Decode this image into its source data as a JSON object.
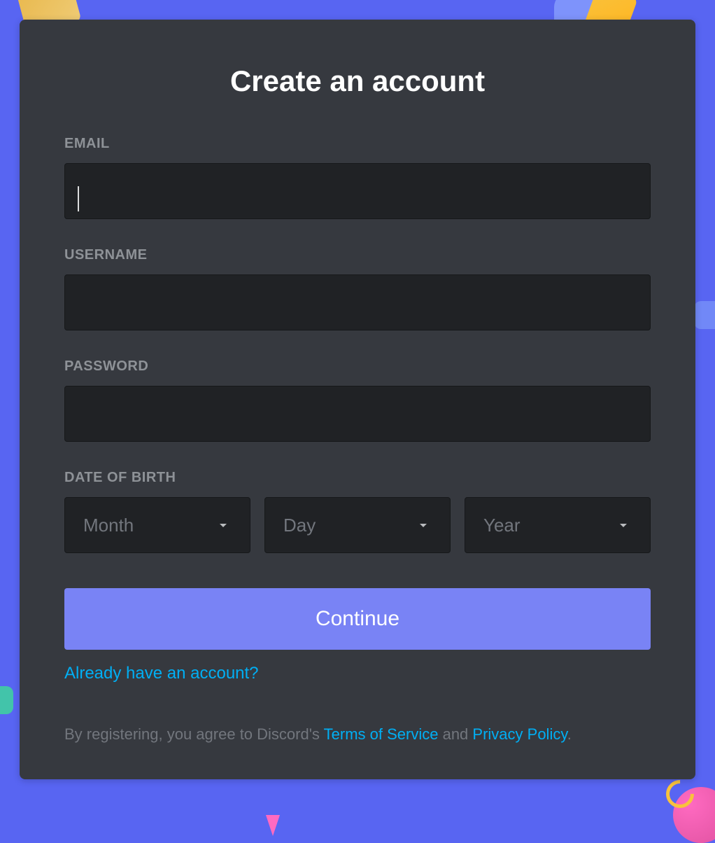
{
  "title": "Create an account",
  "fields": {
    "email": {
      "label": "EMAIL",
      "value": ""
    },
    "username": {
      "label": "USERNAME",
      "value": ""
    },
    "password": {
      "label": "PASSWORD",
      "value": ""
    },
    "dob": {
      "label": "DATE OF BIRTH",
      "month": {
        "placeholder": "Month"
      },
      "day": {
        "placeholder": "Day"
      },
      "year": {
        "placeholder": "Year"
      }
    }
  },
  "buttons": {
    "continue": "Continue"
  },
  "links": {
    "login": "Already have an account?"
  },
  "terms": {
    "prefix": "By registering, you agree to Discord's ",
    "tos": "Terms of Service",
    "middle": " and ",
    "privacy": "Privacy Policy",
    "suffix": "."
  }
}
